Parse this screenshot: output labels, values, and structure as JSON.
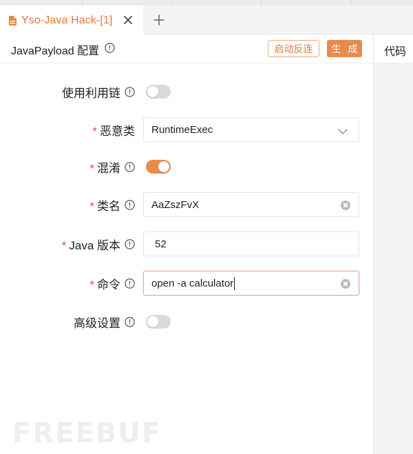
{
  "tab": {
    "label": "Yso-Java Hack-[1]"
  },
  "header": {
    "title": "JavaPayload 配置",
    "reverse_button": "启动反连",
    "generate_button": "生 成"
  },
  "right_panel": {
    "title": "代码"
  },
  "form": {
    "use_chain": {
      "label": "使用利用链",
      "enabled": false
    },
    "malicious_class": {
      "label": "恶意类",
      "value": "RuntimeExec"
    },
    "obfuscate": {
      "label": "混淆",
      "enabled": true
    },
    "class_name": {
      "label": "类名",
      "value": "AaZszFvX"
    },
    "java_version": {
      "label": "Java 版本",
      "value": "52"
    },
    "command": {
      "label": "命令",
      "value": "open -a calculator"
    },
    "advanced": {
      "label": "高级设置",
      "enabled": false
    }
  },
  "required_mark": "*",
  "watermark": "FREEBUF",
  "colors": {
    "accent": "#e88a4a",
    "accent_text": "#e07a3a",
    "required": "#e24a4a"
  }
}
